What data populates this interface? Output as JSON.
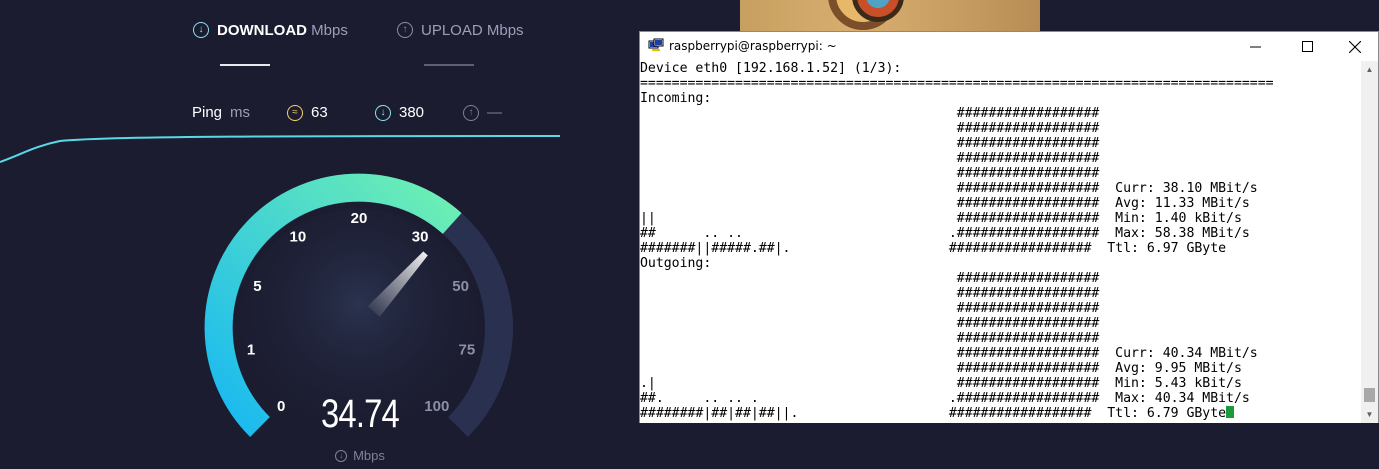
{
  "speedtest": {
    "tabs": {
      "download": {
        "label": "DOWNLOAD",
        "unit": "Mbps"
      },
      "upload": {
        "label": "UPLOAD",
        "unit": "Mbps"
      }
    },
    "ping": {
      "label": "Ping",
      "unit": "ms",
      "idle_value": "63",
      "download_value": "380",
      "upload_value": "—"
    },
    "gauge": {
      "ticks": [
        "0",
        "1",
        "5",
        "10",
        "20",
        "30",
        "50",
        "75",
        "100"
      ],
      "current_value": 34.74,
      "value_text": "34.74",
      "unit": "Mbps",
      "colors": {
        "arc_start": "#18b8f2",
        "arc_end": "#6ff0b2",
        "track": "#2a3150",
        "line": "#5ad8e6"
      }
    }
  },
  "terminal": {
    "title": "raspberrypi@raspberrypi: ~",
    "lines": [
      "Device eth0 [192.168.1.52] (1/3):",
      "================================================================================",
      "Incoming:",
      "                                        ##################",
      "                                        ##################",
      "                                        ##################",
      "                                        ##################",
      "                                        ##################",
      "                                        ##################  Curr: 38.10 MBit/s",
      "                                        ##################  Avg: 11.33 MBit/s",
      "||                                      ##################  Min: 1.40 kBit/s",
      "##      .. ..                          .##################  Max: 58.38 MBit/s",
      "#######||#####.##|.                    ##################  Ttl: 6.97 GByte",
      "Outgoing:",
      "                                        ##################",
      "                                        ##################",
      "                                        ##################",
      "                                        ##################",
      "                                        ##################",
      "                                        ##################  Curr: 40.34 MBit/s",
      "                                        ##################  Avg: 9.95 MBit/s",
      ".|                                      ##################  Min: 5.43 kBit/s",
      "##.     .. .. .                        .##################  Max: 40.34 MBit/s",
      "########|##|##|##||.                   ##################  Ttl: 6.79 GByte"
    ],
    "cursor_color": "#1a9b3a"
  }
}
